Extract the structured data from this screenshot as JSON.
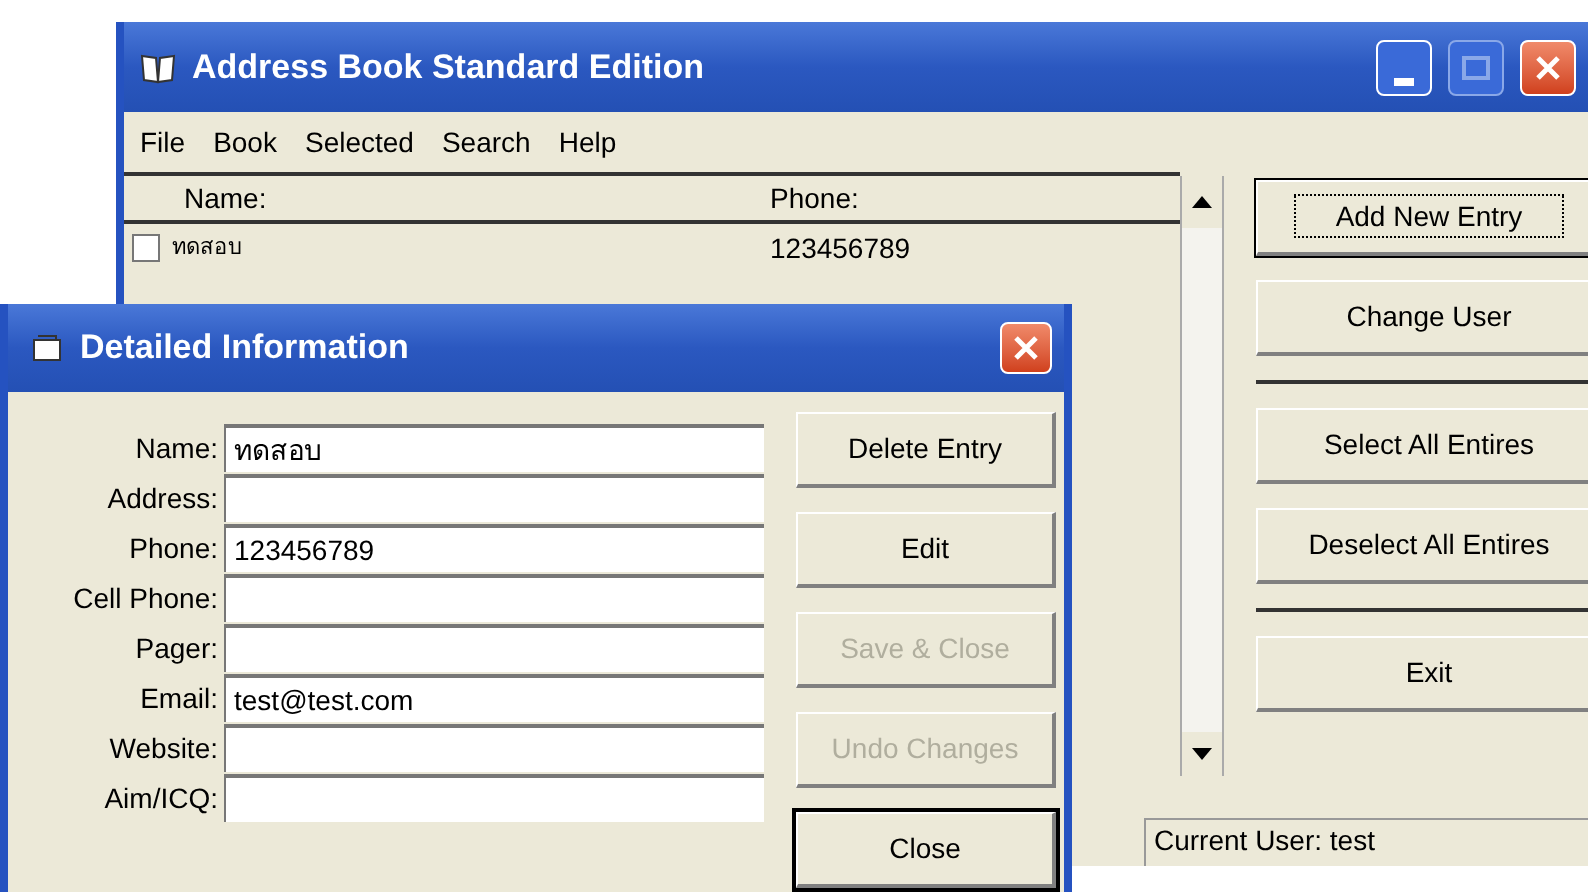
{
  "main_window": {
    "title": "Address Book Standard Edition",
    "menu": [
      "File",
      "Book",
      "Selected",
      "Search",
      "Help"
    ],
    "list": {
      "columns": [
        "Name:",
        "Phone:"
      ],
      "rows": [
        {
          "name": "ทดสอบ",
          "phone": "123456789",
          "checked": false
        }
      ]
    },
    "button_groups": [
      [
        {
          "label": "Add New Entry",
          "focused": true
        },
        {
          "label": "Change User",
          "focused": false
        }
      ],
      [
        {
          "label": "Select All Entires",
          "focused": false
        },
        {
          "label": "Deselect All Entires",
          "focused": false
        }
      ],
      [
        {
          "label": "Exit",
          "focused": false
        }
      ]
    ],
    "status_bar": [
      "Current User: test"
    ]
  },
  "dialog": {
    "title": "Detailed Information",
    "fields": [
      {
        "label": "Name:",
        "value": "ทดสอบ"
      },
      {
        "label": "Address:"
      },
      {
        "label": "Phone:",
        "value": "123456789"
      },
      {
        "label": "Cell Phone:"
      },
      {
        "label": "Pager:"
      },
      {
        "label": "Email:",
        "value": "test@test.com"
      },
      {
        "label": "Website:"
      },
      {
        "label": "Aim/ICQ:"
      }
    ],
    "buttons": [
      {
        "label": "Delete Entry",
        "disabled": false,
        "default": false
      },
      {
        "label": "Edit",
        "disabled": false,
        "default": false
      },
      {
        "label": "Save & Close",
        "disabled": true,
        "default": false
      },
      {
        "label": "Undo Changes",
        "disabled": true,
        "default": false
      },
      {
        "label": "Close",
        "disabled": false,
        "default": true
      }
    ]
  }
}
